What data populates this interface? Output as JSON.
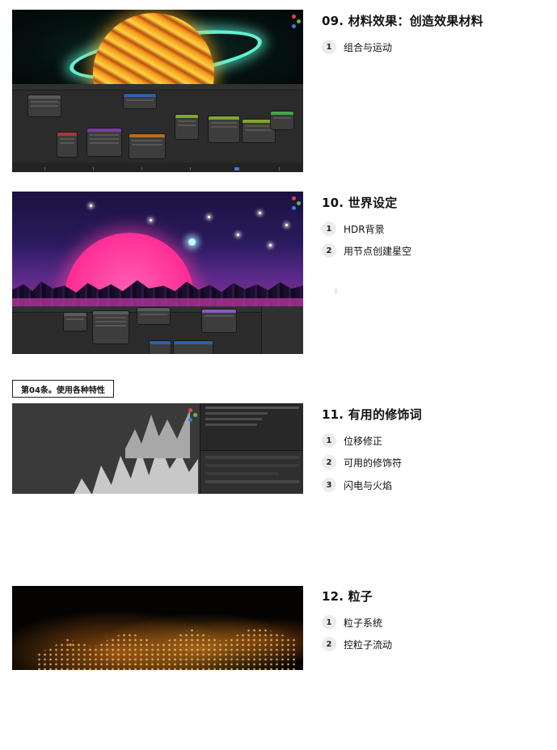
{
  "chapter_label": "第04条。使用各种特性",
  "sections": [
    {
      "number_title": "09. 材料效果：创造效果材料",
      "items": [
        {
          "n": "1",
          "text": "组合与运动"
        }
      ]
    },
    {
      "number_title": "10. 世界设定",
      "items": [
        {
          "n": "1",
          "text": "HDR背景"
        },
        {
          "n": "2",
          "text": "用节点创建星空"
        }
      ]
    },
    {
      "number_title": "11. 有用的修饰词",
      "items": [
        {
          "n": "1",
          "text": "位移修正"
        },
        {
          "n": "2",
          "text": "可用的修饰符"
        },
        {
          "n": "3",
          "text": "闪电与火焰"
        }
      ]
    },
    {
      "number_title": "12. 粒子",
      "items": [
        {
          "n": "1",
          "text": "粒子系统"
        },
        {
          "n": "2",
          "text": "控粒子流动"
        }
      ]
    }
  ],
  "colors": {
    "fire_orange": "#f4a42a",
    "neon_cyan": "#5ff2d2",
    "sunset_pink": "#ff2f96",
    "night_purple": "#2a1a5e",
    "blender_bg": "#2b2b2b",
    "particle_glow": "#ffb23a"
  },
  "icons": [
    "gizmo-axis-icon",
    "timeline-marker-icon",
    "numbered-bullet-icon"
  ]
}
